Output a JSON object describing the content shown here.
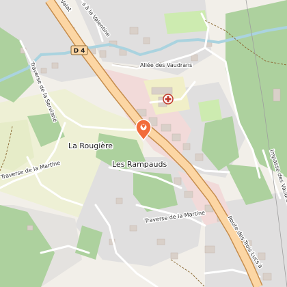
{
  "map": {
    "shield": {
      "ref": "D 4"
    },
    "places": {
      "la_rougiere": "La Rougière",
      "les_rampauds": "Les Rampauds"
    },
    "roads": {
      "allee_des_vaudrans": "Allée des Vaudrans",
      "traverse_de_la_serviane": "Traverse de la Serviane",
      "traverse_de_la_martine_west": "Traverse de la Martine",
      "traverse_de_la_martine_south": "Traverse de la Martine",
      "impasse_des_vaudrans": "Impasse des Vaudrans",
      "route_des_trois_lucs": "Route des Trois Lucs à",
      "bd_de_la_valentine": "s à la Valentine",
      "top_fragment": "Valat"
    },
    "pois": [
      {
        "name": "hospital",
        "icon": "hospital-cross-icon",
        "color": "#c0392b"
      },
      {
        "name": "selected-location",
        "icon": "map-pin-icon",
        "color": "#f26b3a"
      }
    ],
    "colors": {
      "land": "#f2efe9",
      "forest": "#add19e",
      "grass": "#cdebb0",
      "farmland": "#eef0d5",
      "residential": "#e0dfdf",
      "commercial": "#f2dad9",
      "buildings": "#d9d0c9",
      "water": "#aad3df",
      "primary_road": "#fcd6a4",
      "primary_road_casing": "#c68d4d",
      "hospital_area": "#f1efc8"
    }
  }
}
